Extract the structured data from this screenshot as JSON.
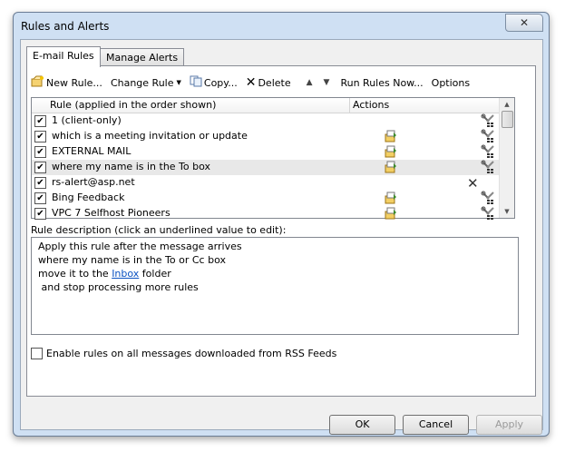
{
  "window": {
    "title": "Rules and Alerts",
    "close_glyph": "✕"
  },
  "tabs": [
    {
      "label": "E-mail Rules",
      "active": true
    },
    {
      "label": "Manage Alerts",
      "active": false
    }
  ],
  "toolbar": {
    "new_rule": "New Rule...",
    "change_rule": "Change Rule",
    "copy": "Copy...",
    "delete": "Delete",
    "run_rules": "Run Rules Now...",
    "options": "Options"
  },
  "list": {
    "header_rule": "Rule (applied in the order shown)",
    "header_actions": "Actions",
    "rows": [
      {
        "label": "1  (client-only)",
        "checked": true,
        "move_icon": false,
        "tools": true,
        "delete_x": false
      },
      {
        "label": "which is a meeting invitation or update",
        "checked": true,
        "move_icon": true,
        "tools": true,
        "delete_x": false
      },
      {
        "label": "EXTERNAL MAIL",
        "checked": true,
        "move_icon": true,
        "tools": true,
        "delete_x": false
      },
      {
        "label": "where my name is in the To box",
        "checked": true,
        "move_icon": true,
        "tools": true,
        "delete_x": false,
        "selected": true
      },
      {
        "label": "rs-alert@asp.net",
        "checked": true,
        "move_icon": false,
        "tools": false,
        "delete_x": true
      },
      {
        "label": "Bing Feedback",
        "checked": true,
        "move_icon": true,
        "tools": true,
        "delete_x": false
      },
      {
        "label": "VPC 7 Selfhost Pioneers",
        "checked": true,
        "move_icon": true,
        "tools": true,
        "delete_x": false
      }
    ]
  },
  "description": {
    "label": "Rule description (click an underlined value to edit):",
    "line1": "Apply this rule after the message arrives",
    "line2": "where my name is in the To or Cc box",
    "line3_prefix": "move it to the",
    "line3_link": "Inbox",
    "line3_suffix": "folder",
    "line4": " and stop processing more rules"
  },
  "rss": {
    "label": "Enable rules on all messages downloaded from RSS Feeds",
    "checked": false
  },
  "buttons": {
    "ok": "OK",
    "cancel": "Cancel",
    "apply": "Apply"
  },
  "colors": {
    "window_frame": "#cfe0f3",
    "link": "#0b52c2",
    "selection": "#e8e8e8"
  }
}
